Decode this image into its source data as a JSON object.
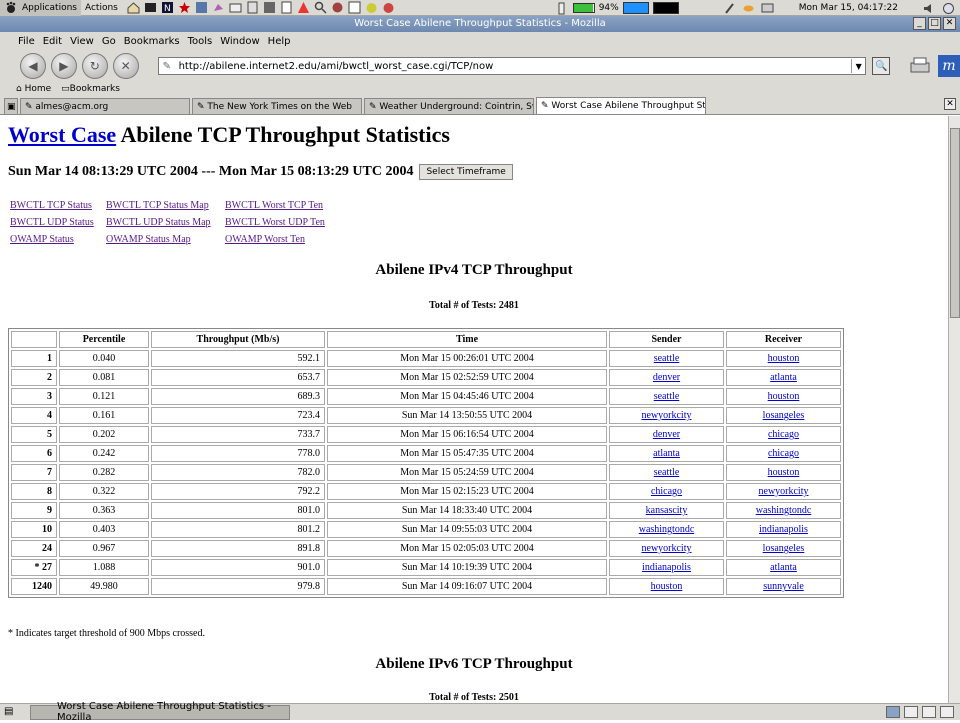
{
  "panel": {
    "applications": "Applications",
    "actions": "Actions",
    "battery": "94%",
    "clock": "Mon Mar 15, 04:17:22"
  },
  "window": {
    "title": "Worst Case Abilene Throughput Statistics - Mozilla"
  },
  "menubar": [
    "File",
    "Edit",
    "View",
    "Go",
    "Bookmarks",
    "Tools",
    "Window",
    "Help"
  ],
  "nav": {
    "url": "http://abilene.internet2.edu/ami/bwctl_worst_case.cgi/TCP/now"
  },
  "personal": {
    "home": "Home",
    "bookmarks": "Bookmarks"
  },
  "tabs": [
    "almes@acm.org",
    "The New York Times on the Web",
    "Weather Underground: Cointrin, Swi...",
    "Worst Case Abilene Throughput St..."
  ],
  "page": {
    "heading_link": "Worst Case",
    "heading_rest": " Abilene TCP Throughput Statistics",
    "timeframe": "Sun Mar 14 08:13:29 UTC 2004 --- Mon Mar 15 08:13:29 UTC 2004",
    "timeframe_button": "Select Timeframe",
    "links": [
      [
        "BWCTL TCP Status",
        "BWCTL TCP Status Map",
        "BWCTL Worst TCP Ten"
      ],
      [
        "BWCTL UDP Status",
        "BWCTL UDP Status Map",
        "BWCTL Worst UDP Ten"
      ],
      [
        "OWAMP Status",
        "OWAMP Status Map",
        "OWAMP Worst Ten"
      ]
    ],
    "ipv4_title": "Abilene IPv4 TCP Throughput",
    "ipv4_total": "Total # of Tests: 2481",
    "table_headers": [
      "",
      "Percentile",
      "Throughput (Mb/s)",
      "Time",
      "Sender",
      "Receiver"
    ],
    "rows": [
      [
        "1",
        "0.040",
        "592.1",
        "Mon Mar 15 00:26:01 UTC 2004",
        "seattle",
        "houston"
      ],
      [
        "2",
        "0.081",
        "653.7",
        "Mon Mar 15 02:52:59 UTC 2004",
        "denver",
        "atlanta"
      ],
      [
        "3",
        "0.121",
        "689.3",
        "Mon Mar 15 04:45:46 UTC 2004",
        "seattle",
        "houston"
      ],
      [
        "4",
        "0.161",
        "723.4",
        "Sun Mar 14 13:50:55 UTC 2004",
        "newyorkcity",
        "losangeles"
      ],
      [
        "5",
        "0.202",
        "733.7",
        "Mon Mar 15 06:16:54 UTC 2004",
        "denver",
        "chicago"
      ],
      [
        "6",
        "0.242",
        "778.0",
        "Mon Mar 15 05:47:35 UTC 2004",
        "atlanta",
        "chicago"
      ],
      [
        "7",
        "0.282",
        "782.0",
        "Mon Mar 15 05:24:59 UTC 2004",
        "seattle",
        "houston"
      ],
      [
        "8",
        "0.322",
        "792.2",
        "Mon Mar 15 02:15:23 UTC 2004",
        "chicago",
        "newyorkcity"
      ],
      [
        "9",
        "0.363",
        "801.0",
        "Sun Mar 14 18:33:40 UTC 2004",
        "kansascity",
        "washingtondc"
      ],
      [
        "10",
        "0.403",
        "801.2",
        "Sun Mar 14 09:55:03 UTC 2004",
        "washingtondc",
        "indianapolis"
      ],
      [
        "24",
        "0.967",
        "891.8",
        "Mon Mar 15 02:05:03 UTC 2004",
        "newyorkcity",
        "losangeles"
      ],
      [
        "* 27",
        "1.088",
        "901.0",
        "Sun Mar 14 10:19:39 UTC 2004",
        "indianapolis",
        "atlanta"
      ],
      [
        "1240",
        "49.980",
        "979.8",
        "Sun Mar 14 09:16:07 UTC 2004",
        "houston",
        "sunnyvale"
      ]
    ],
    "footnote": "* Indicates target threshold of 900 Mbps crossed.",
    "ipv6_title": "Abilene IPv6 TCP Throughput",
    "ipv6_total": "Total # of Tests: 2501"
  },
  "taskbar": {
    "task": "Worst Case Abilene Throughput Statistics - Mozilla"
  }
}
